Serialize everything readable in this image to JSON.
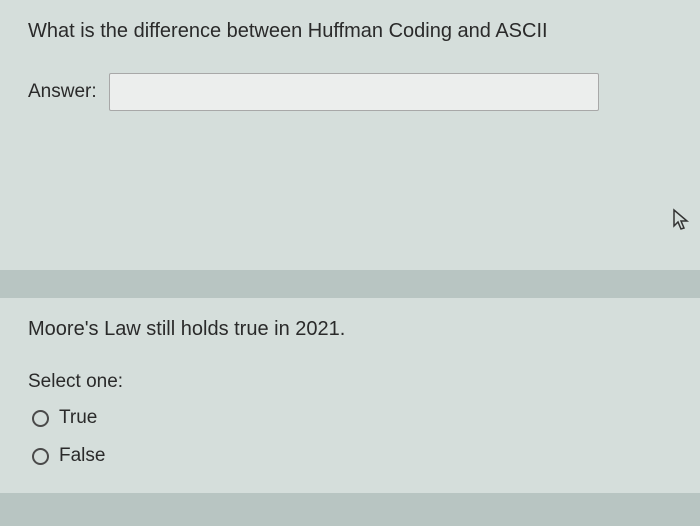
{
  "question1": {
    "prompt": "What is the difference between Huffman Coding and ASCII",
    "answer_label": "Answer:",
    "answer_value": ""
  },
  "question2": {
    "prompt": "Moore's Law still holds true in 2021.",
    "select_label": "Select one:",
    "options": {
      "true": "True",
      "false": "False"
    }
  }
}
